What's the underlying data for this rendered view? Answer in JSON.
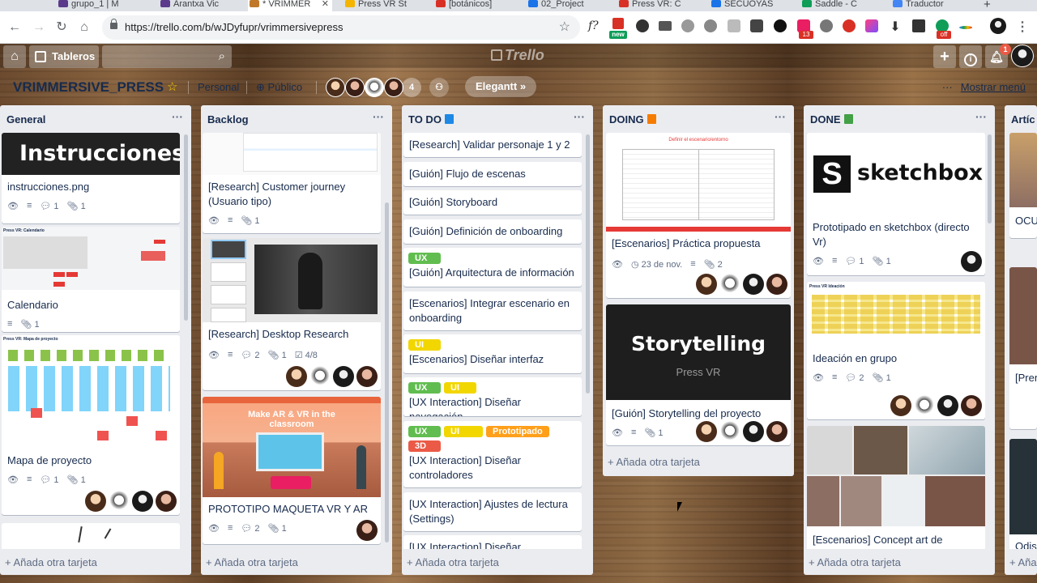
{
  "browser": {
    "tabs": [
      {
        "title": "grupo_1 | M",
        "color": "#5b3a8c"
      },
      {
        "title": "Arantxa Vic",
        "color": "#5b3a8c"
      },
      {
        "title": "* VRIMMER",
        "color": "#c0792a",
        "active": true
      },
      {
        "title": "Press VR St",
        "color": "#f4b400"
      },
      {
        "title": "[botánicos]",
        "color": "#d93025"
      },
      {
        "title": "02_Project",
        "color": "#1a73e8"
      },
      {
        "title": "Press VR: C",
        "color": "#d93025"
      },
      {
        "title": "SECUOYAS",
        "color": "#1a73e8"
      },
      {
        "title": "Saddle - C",
        "color": "#0f9d58"
      },
      {
        "title": "Traductor",
        "color": "#4285f4"
      }
    ],
    "new_tab": "+",
    "url": "https://trello.com/b/wJDyfupr/vrimmersivepress",
    "ext_badges": [
      "new",
      "13",
      "off"
    ]
  },
  "header": {
    "boards_label": "Tableros",
    "logo_text": "Trello",
    "notif_count": "1"
  },
  "board": {
    "title": "VRIMMERSIVE_PRESS",
    "team": "Personal",
    "visibility": "Público",
    "member_count": "4",
    "power_up": "Elegantt »",
    "show_menu": "Mostrar menú"
  },
  "lists": [
    {
      "name": "General",
      "add_card": "+ Añada otra tarjeta",
      "cards": [
        {
          "cover_text": "Instrucciones",
          "title": "instrucciones.png",
          "comments": "1",
          "attachments": "1"
        },
        {
          "cover_caption": "Press VR: Calendario",
          "title": "Calendario",
          "attachments": "1"
        },
        {
          "cover_caption": "Press VR: Mapa de proyecto",
          "title": "Mapa de proyecto",
          "comments": "1",
          "attachments": "1"
        }
      ]
    },
    {
      "name": "Backlog",
      "add_card": "+ Añada otra tarjeta",
      "cards": [
        {
          "title": "[Research] Customer journey (Usuario tipo)",
          "attachments": "1"
        },
        {
          "title": "[Research] Desktop Research",
          "comments": "2",
          "attachments": "1",
          "checklist": "4/8"
        },
        {
          "cover_text": "Make AR & VR in the classroom",
          "title": "PROTOTIPO MAQUETA VR Y AR",
          "comments": "2",
          "attachments": "1"
        }
      ]
    },
    {
      "name": "TO DO",
      "add_card": "+ Añada otra tarjeta",
      "cards": [
        {
          "title": "[Research] Validar personaje 1 y 2"
        },
        {
          "title": "[Guión] Flujo de escenas"
        },
        {
          "title": "[Guión] Storyboard"
        },
        {
          "title": "[Guión] Definición de onboarding"
        },
        {
          "labels": [
            "UX"
          ],
          "title": "[Guión] Arquitectura de información"
        },
        {
          "title": "[Escenarios] Integrar escenario en onboarding"
        },
        {
          "labels": [
            "UI"
          ],
          "title": "[Escenarios] Diseñar interfaz"
        },
        {
          "labels": [
            "UX",
            "UI"
          ],
          "title": "[UX Interaction] Diseñar navegación"
        },
        {
          "labels": [
            "UX",
            "UI",
            "Prototipado",
            "3D"
          ],
          "title": "[UX Interaction] Diseñar controladores"
        },
        {
          "title": "[UX Interaction] Ajustes de lectura (Settings)"
        },
        {
          "title": "[UX Interaction] Diseñar animaciones"
        }
      ]
    },
    {
      "name": "DOING",
      "add_card": "+ Añada otra tarjeta",
      "cards": [
        {
          "cover_caption": "Definir el escenario/entorno",
          "title": "[Escenarios] Práctica propuesta",
          "due": "23 de nov.",
          "attachments": "2"
        },
        {
          "cover_text": "Storytelling",
          "cover_sub": "Press VR",
          "title": "[Guión] Storytelling del proyecto",
          "attachments": "1"
        }
      ]
    },
    {
      "name": "DONE",
      "add_card": "+ Añada otra tarjeta",
      "cards": [
        {
          "cover_text": "sketchbox",
          "title": "Prototipado en sketchbox (directo Vr)",
          "comments": "1",
          "attachments": "1"
        },
        {
          "cover_caption": "Press VR Ideación",
          "title": "Ideación en grupo",
          "comments": "2",
          "attachments": "1"
        },
        {
          "title": "[Escenarios] Concept art de escenarios"
        }
      ]
    },
    {
      "name": "Artíc",
      "add_card": "+ Aña",
      "cards": [
        {
          "title": "OCU"
        },
        {
          "title": "[Pren"
        },
        {
          "title": "Odis"
        }
      ]
    }
  ],
  "colors": {
    "green": "#61bd4f",
    "yellow": "#f2d600",
    "orange": "#ff9f1a",
    "red": "#eb5a46",
    "list_bg": "#ebecf0"
  }
}
